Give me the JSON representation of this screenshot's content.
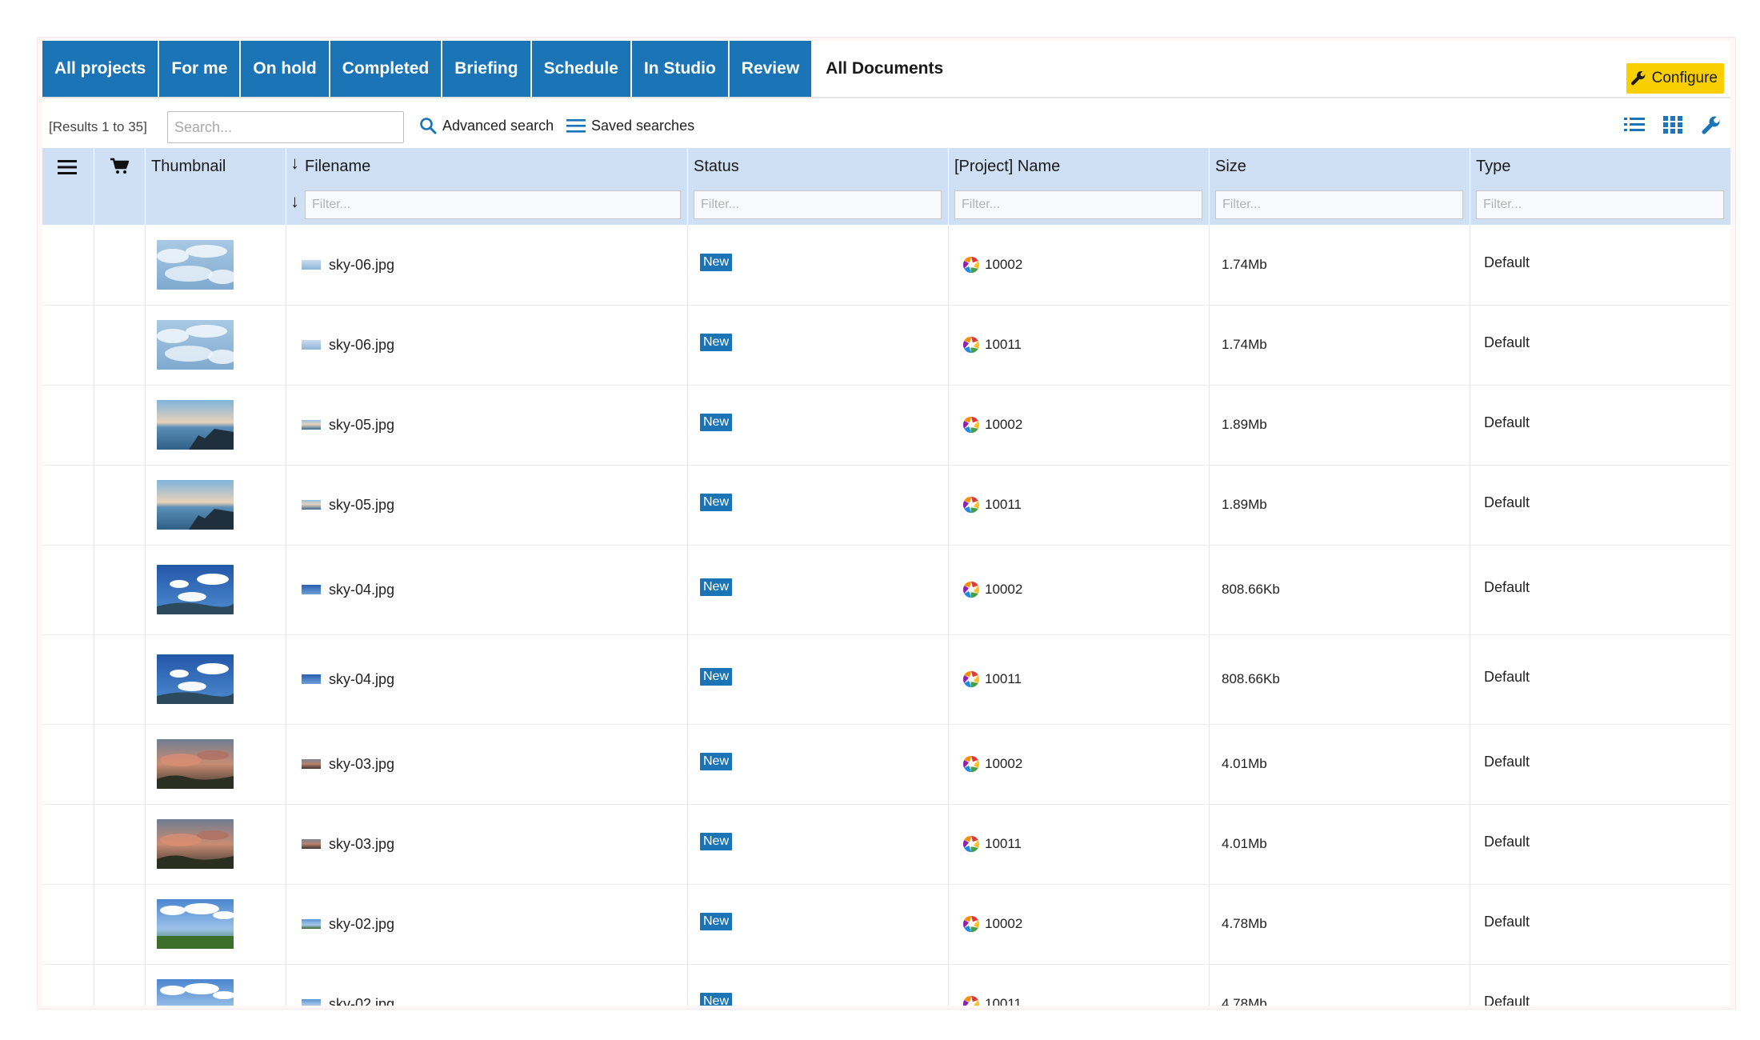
{
  "tabs": [
    "All projects",
    "For me",
    "On hold",
    "Completed",
    "Briefing",
    "Schedule",
    "In Studio",
    "Review",
    "All Documents"
  ],
  "active_tab": "All Documents",
  "configure_label": "Configure",
  "toolbar": {
    "results": "[Results 1 to 35]",
    "search_placeholder": "Search...",
    "advanced_search": "Advanced search",
    "saved_searches": "Saved searches"
  },
  "columns": {
    "thumbnail": "Thumbnail",
    "filename": "Filename",
    "status": "Status",
    "project_name": "[Project] Name",
    "size": "Size",
    "type": "Type",
    "filter_placeholder": "Filter..."
  },
  "rows": [
    {
      "thumb": "sky06",
      "filename": "sky-06.jpg",
      "status": "New",
      "project": "10002",
      "size": "1.74Mb",
      "type": "Default"
    },
    {
      "thumb": "sky06",
      "filename": "sky-06.jpg",
      "status": "New",
      "project": "10011",
      "size": "1.74Mb",
      "type": "Default"
    },
    {
      "thumb": "sky05",
      "filename": "sky-05.jpg",
      "status": "New",
      "project": "10002",
      "size": "1.89Mb",
      "type": "Default"
    },
    {
      "thumb": "sky05",
      "filename": "sky-05.jpg",
      "status": "New",
      "project": "10011",
      "size": "1.89Mb",
      "type": "Default"
    },
    {
      "thumb": "sky04",
      "filename": "sky-04.jpg",
      "status": "New",
      "project": "10002",
      "size": "808.66Kb",
      "type": "Default"
    },
    {
      "thumb": "sky04",
      "filename": "sky-04.jpg",
      "status": "New",
      "project": "10011",
      "size": "808.66Kb",
      "type": "Default"
    },
    {
      "thumb": "sky03",
      "filename": "sky-03.jpg",
      "status": "New",
      "project": "10002",
      "size": "4.01Mb",
      "type": "Default"
    },
    {
      "thumb": "sky03",
      "filename": "sky-03.jpg",
      "status": "New",
      "project": "10011",
      "size": "4.01Mb",
      "type": "Default"
    },
    {
      "thumb": "sky02",
      "filename": "sky-02.jpg",
      "status": "New",
      "project": "10002",
      "size": "4.78Mb",
      "type": "Default"
    },
    {
      "thumb": "sky02",
      "filename": "sky-02.jpg",
      "status": "New",
      "project": "10011",
      "size": "4.78Mb",
      "type": "Default"
    }
  ],
  "colors": {
    "accent": "#1a74b6",
    "header_bg": "#cfe0f4",
    "configure_bg": "#f9cf00"
  }
}
